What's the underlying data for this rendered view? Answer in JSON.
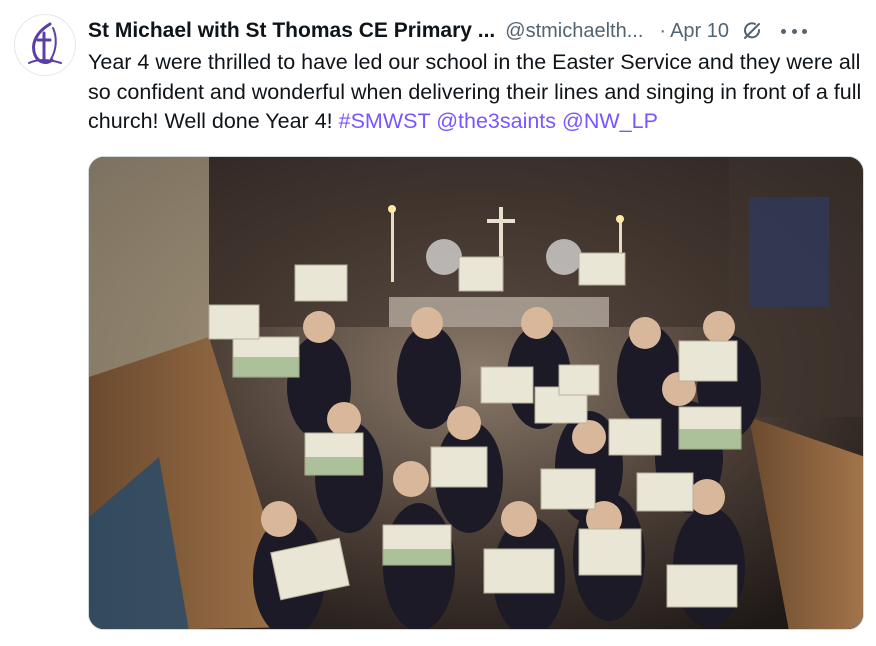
{
  "tweet": {
    "display_name": "St Michael with St Thomas CE Primary ...",
    "handle": "@stmichaelth...",
    "separator": "·",
    "timestamp": "Apr 10",
    "text_before": "Year 4 were thrilled to have led our school in the Easter Service and they were all so confident and wonderful when delivering their lines and singing in front of a full church! Well done Year 4! ",
    "hashtag": "#SMWST",
    "mention_1": "@the3saints",
    "mention_2": "@NW_LP",
    "media_icon": "photo"
  },
  "icons": {
    "avatar": "school-cross-logo",
    "grok": "grok-icon",
    "more": "more-icon"
  },
  "colors": {
    "link": "#7856ff",
    "text": "#0f1419",
    "secondary": "#536471",
    "avatar_accent": "#5b3fa8"
  }
}
